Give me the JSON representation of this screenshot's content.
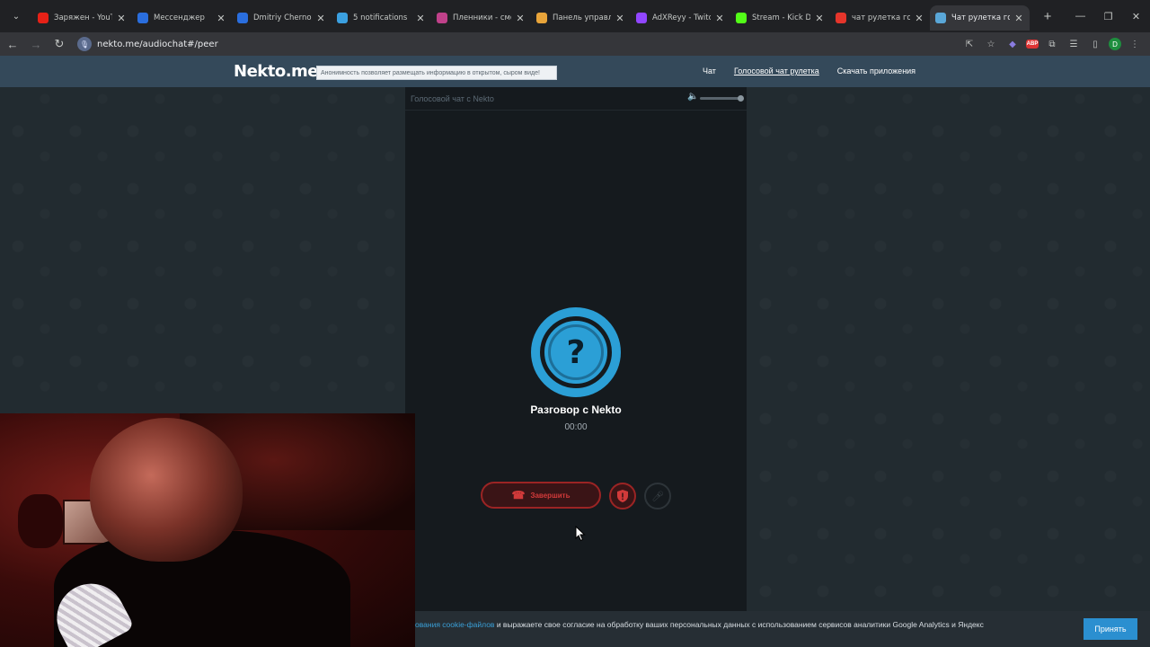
{
  "browser": {
    "tabs": [
      {
        "title": "Заряжен - YouTube",
        "favicon": "youtube-icon",
        "color": "#e62117"
      },
      {
        "title": "Мессенджер",
        "favicon": "messenger-icon",
        "color": "#2a6ede"
      },
      {
        "title": "Dmitriy Chernov",
        "favicon": "messenger-icon",
        "color": "#2a6ede"
      },
      {
        "title": "5 notifications",
        "favicon": "telegram-icon",
        "color": "#3ba0e0"
      },
      {
        "title": "Пленники - смотреть",
        "favicon": "video-icon",
        "color": "#c0418a"
      },
      {
        "title": "Панель управления",
        "favicon": "donation-icon",
        "color": "#e8a43a"
      },
      {
        "title": "AdXReyy - Twitch",
        "favicon": "twitch-icon",
        "color": "#9146ff"
      },
      {
        "title": "Stream - Kick Dashboard",
        "favicon": "kick-icon",
        "color": "#53fc18"
      },
      {
        "title": "чат рулетка голосовой",
        "favicon": "yandex-icon",
        "color": "#e5352b"
      },
      {
        "title": "Чат рулетка голосовой",
        "favicon": "nekto-icon",
        "color": "#5aa7d8",
        "active": true
      }
    ],
    "url": "nekto.me/audiochat#/peer"
  },
  "site": {
    "logo": "Nekto.me",
    "notice": "Анонимность позволяет размещать информацию в открытом, сыром виде!",
    "nav": {
      "chat": "Чат",
      "voice_chat": "Голосовой чат рулетка",
      "download": "Скачать приложения"
    }
  },
  "panel": {
    "title": "Голосовой чат с Nekto",
    "conversation_title": "Разговор с Nekto",
    "timer": "00:00",
    "avatar_symbol": "?",
    "end_button": "Завершить",
    "volume_level": 1.0
  },
  "cookie": {
    "link_text": "ования cookie-файлов",
    "text": " и выражаете свое согласие на обработку ваших персональных данных с использованием сервисов аналитики Google Analytics и Яндекс",
    "accept": "Принять"
  },
  "colors": {
    "accent": "#2b9fd6",
    "danger": "#d23a3a",
    "header": "#34495a"
  }
}
